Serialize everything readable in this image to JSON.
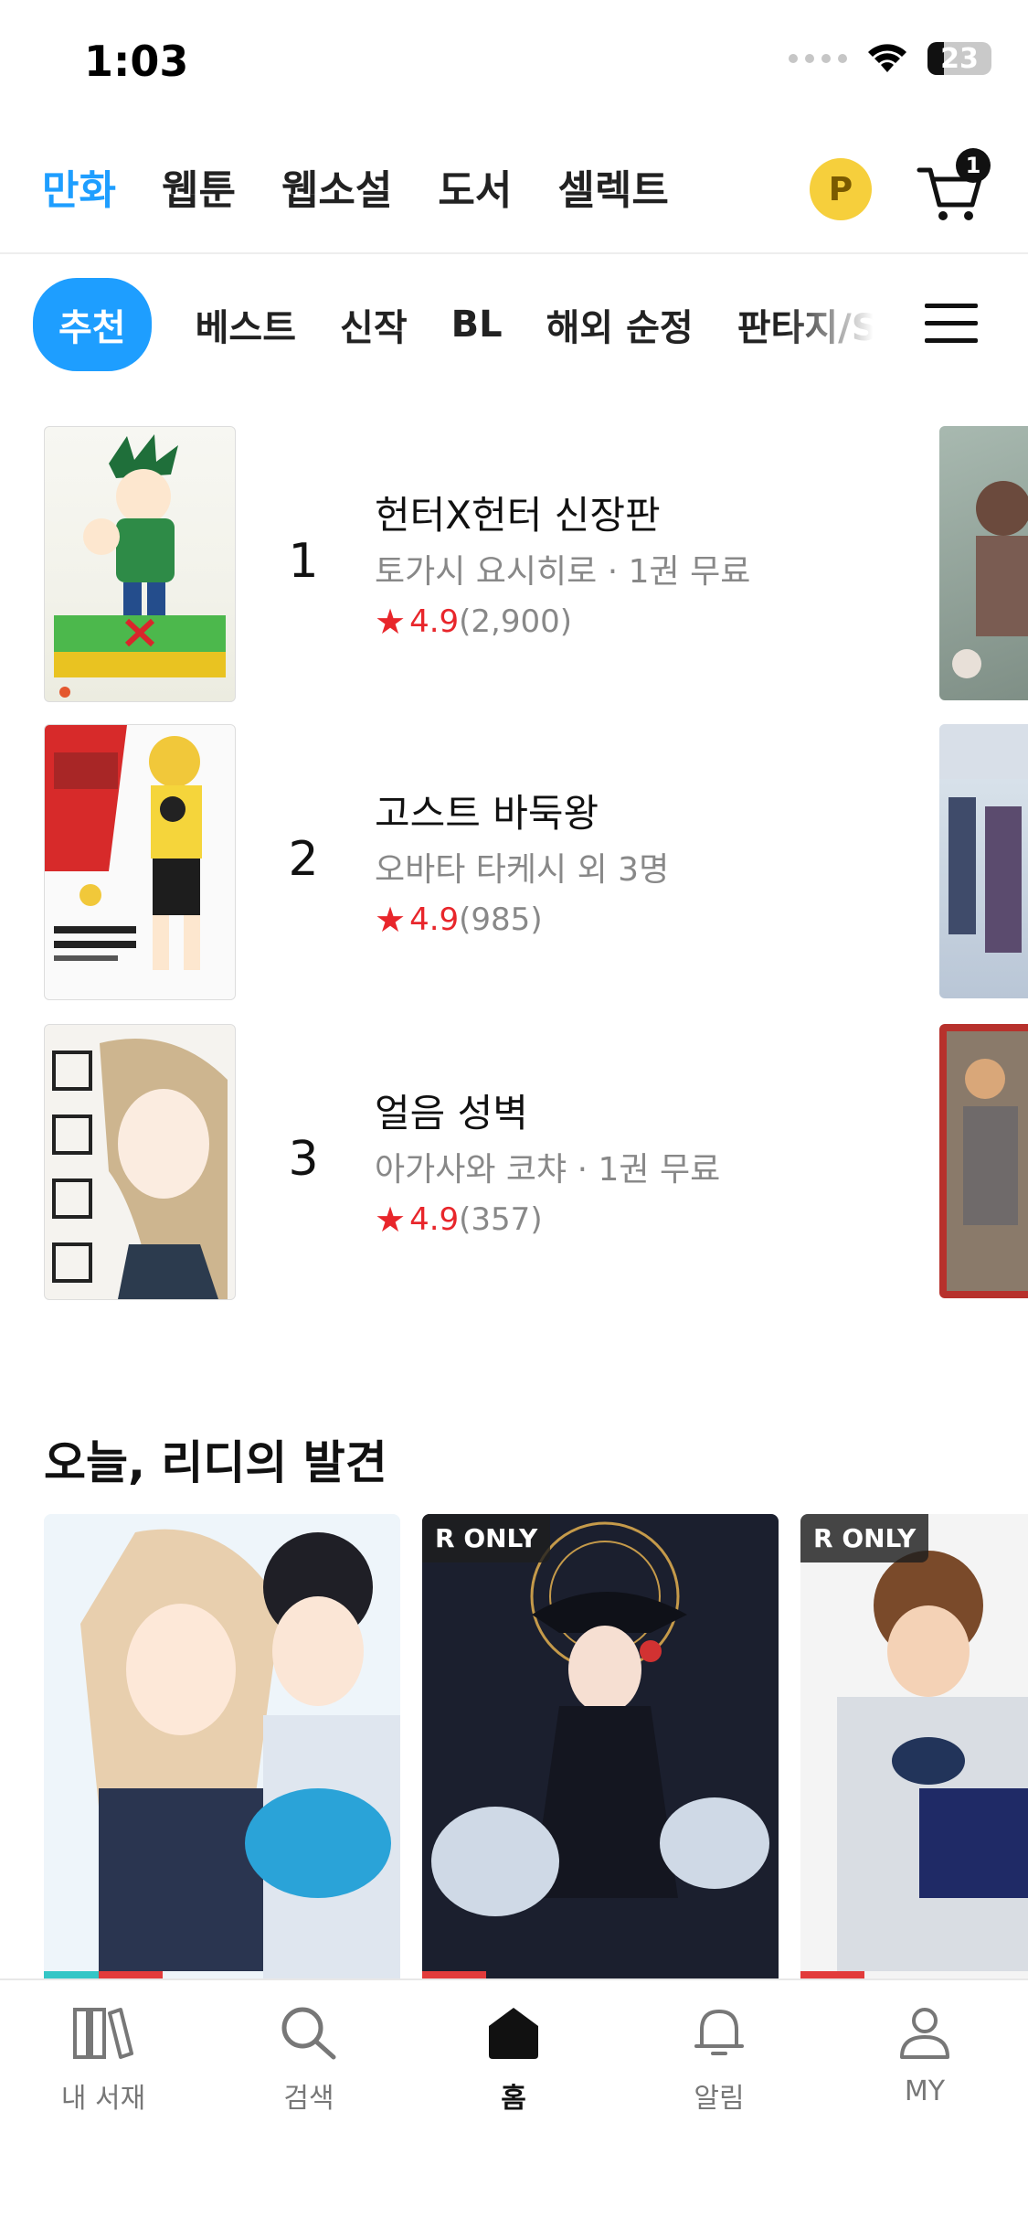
{
  "status": {
    "time": "1:03",
    "battery": "23"
  },
  "topnav": {
    "tabs": [
      "만화",
      "웹툰",
      "웹소설",
      "도서",
      "셀렉트"
    ],
    "active": 0,
    "point_label": "P",
    "cart_count": "1"
  },
  "genres": {
    "items": [
      "추천",
      "베스트",
      "신작",
      "BL",
      "해외 순정",
      "판타지/S"
    ],
    "active": 0
  },
  "ranking": [
    {
      "rank": "1",
      "title": "헌터X헌터 신장판",
      "sub": "토가시 요시히로 · 1권 무료",
      "score": "4.9",
      "count": "(2,900)"
    },
    {
      "rank": "2",
      "title": "고스트 바둑왕",
      "sub": "오바타 타케시 외 3명",
      "score": "4.9",
      "count": "(985)"
    },
    {
      "rank": "3",
      "title": "얼음 성벽",
      "sub": "아가사와 코챠 · 1권 무료",
      "score": "4.9",
      "count": "(357)"
    }
  ],
  "discovery": {
    "title": "오늘, 리디의 발견",
    "badges": [
      "ONLY",
      "ONLY"
    ]
  },
  "bottom_tabs": [
    {
      "label": "내 서재",
      "icon": "library-icon"
    },
    {
      "label": "검색",
      "icon": "search-icon"
    },
    {
      "label": "홈",
      "icon": "home-icon"
    },
    {
      "label": "알림",
      "icon": "bell-icon"
    },
    {
      "label": "MY",
      "icon": "person-icon"
    }
  ],
  "colors": {
    "accent": "#1e9eff",
    "star": "#e8262b",
    "point": "#f6cf3c"
  }
}
